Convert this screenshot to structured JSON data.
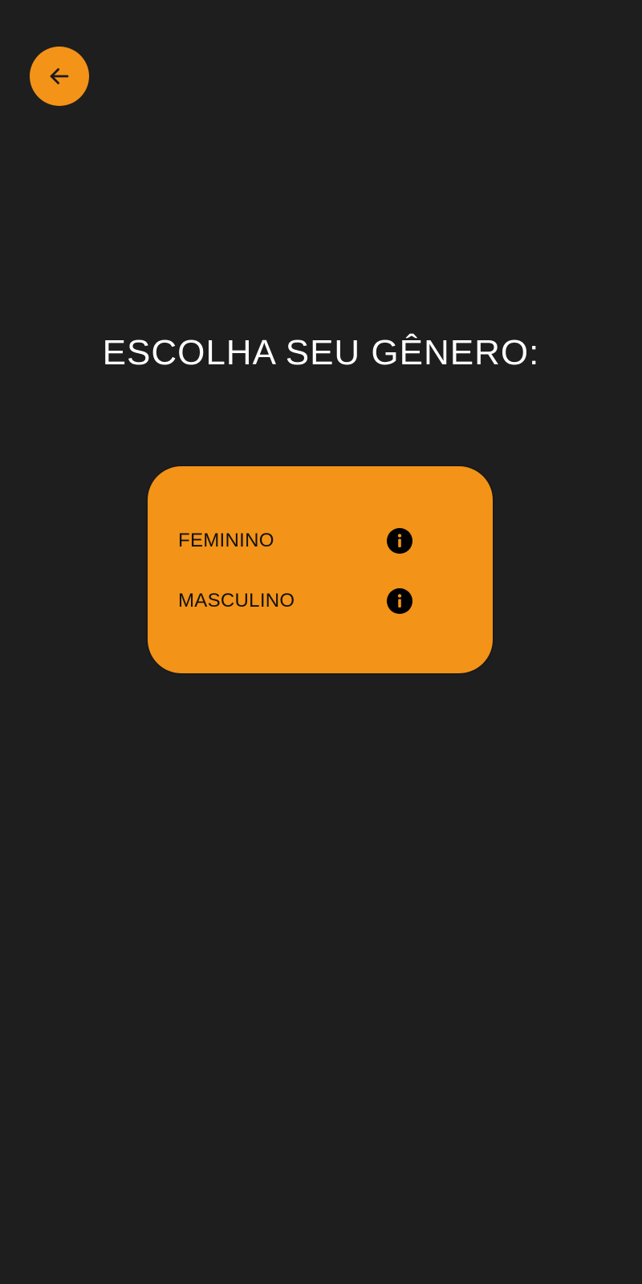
{
  "navigation": {
    "back_icon": "arrow-left-icon",
    "accent_color": "#f39318"
  },
  "screen": {
    "title": "ESCOLHA SEU GÊNERO:",
    "background_color": "#1e1e1e"
  },
  "gender_options": [
    {
      "label": "FEMININO",
      "icon": "info-icon"
    },
    {
      "label": "MASCULINO",
      "icon": "info-icon"
    }
  ]
}
